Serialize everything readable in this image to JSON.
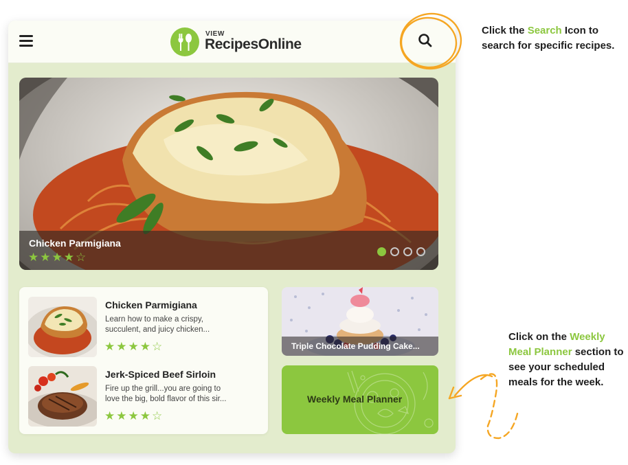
{
  "header": {
    "logo_small": "VIEW",
    "logo_main": "RecipesOnline",
    "menu_icon": "hamburger-icon",
    "search_icon": "search-icon"
  },
  "hero": {
    "title": "Chicken Parmigiana",
    "stars": "★★★★☆",
    "rating": 4,
    "slides": 4,
    "active_slide": 1
  },
  "recipes": [
    {
      "title": "Chicken Parmigiana",
      "desc_line1": "Learn how to make a crispy,",
      "desc_line2": "succulent, and juicy chicken...",
      "stars": "★★★★☆",
      "rating": 4
    },
    {
      "title": "Jerk-Spiced Beef Sirloin",
      "desc_line1": "Fire up the grill...you are going to",
      "desc_line2": "love the big, bold flavor of this sir...",
      "stars": "★★★★☆",
      "rating": 4
    }
  ],
  "tiles": {
    "cake_label": "Triple Chocolate Pudding Cake...",
    "planner_label": "Weekly Meal Planner"
  },
  "annotations": {
    "note1_pre": "Click the ",
    "note1_hl": "Search",
    "note1_post": " Icon to search for specific recipes.",
    "note2_pre": "Click on the ",
    "note2_hl": "Weekly Meal Planner",
    "note2_post": " section to see your scheduled meals for the week."
  },
  "colors": {
    "accent": "#8cc73f",
    "panel": "#e3eccd",
    "annotation_orange": "#f5a623"
  }
}
